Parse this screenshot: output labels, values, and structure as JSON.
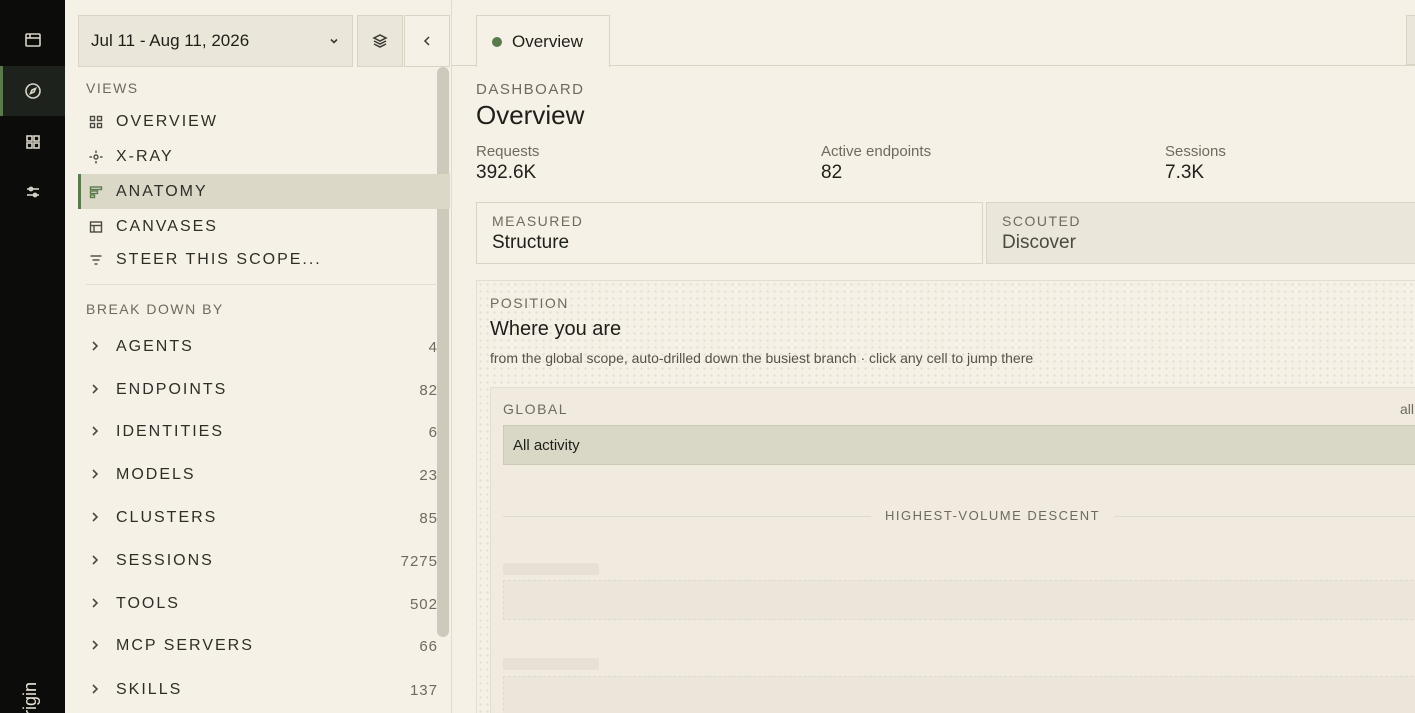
{
  "rail": {
    "items": [
      {
        "icon": "calendar-icon"
      },
      {
        "icon": "compass-icon",
        "active": true
      },
      {
        "icon": "grid-icon"
      },
      {
        "icon": "sliders-icon"
      }
    ],
    "brand": "rigin"
  },
  "sidebar": {
    "date_range": "Jul 11 - Aug 11, 2026",
    "views_title": "VIEWS",
    "views": [
      {
        "label": "OVERVIEW",
        "icon": "grid-icon"
      },
      {
        "label": "X-RAY",
        "icon": "crosshair-icon"
      },
      {
        "label": "ANATOMY",
        "icon": "bars-icon",
        "active": true
      },
      {
        "label": "CANVASES",
        "icon": "canvas-icon"
      },
      {
        "label": "STEER THIS SCOPE...",
        "icon": "filter-icon"
      }
    ],
    "breakdown_title": "BREAK DOWN BY",
    "breakdown": [
      {
        "label": "AGENTS",
        "count": "4"
      },
      {
        "label": "ENDPOINTS",
        "count": "82"
      },
      {
        "label": "IDENTITIES",
        "count": "6"
      },
      {
        "label": "MODELS",
        "count": "23"
      },
      {
        "label": "CLUSTERS",
        "count": "85"
      },
      {
        "label": "SESSIONS",
        "count": "7275"
      },
      {
        "label": "TOOLS",
        "count": "502"
      },
      {
        "label": "MCP SERVERS",
        "count": "66"
      },
      {
        "label": "SKILLS",
        "count": "137"
      }
    ]
  },
  "main": {
    "tab": {
      "label": "Overview"
    },
    "eyebrow": "DASHBOARD",
    "title": "Overview",
    "stats": [
      {
        "label": "Requests",
        "value": "392.6K"
      },
      {
        "label": "Active endpoints",
        "value": "82"
      },
      {
        "label": "Sessions",
        "value": "7.3K"
      }
    ],
    "modes": [
      {
        "kicker": "MEASURED",
        "label": "Structure",
        "selected": true
      },
      {
        "kicker": "SCOUTED",
        "label": "Discover",
        "selected": false
      }
    ],
    "position": {
      "kicker": "POSITION",
      "title": "Where you are",
      "description": "from the global scope, auto-drilled down the busiest branch · click any cell to jump there",
      "global_label": "GLOBAL",
      "global_right": "all",
      "global_bar": "All activity",
      "descent_label": "HIGHEST-VOLUME DESCENT"
    }
  },
  "colors": {
    "accent": "#5a7a4c",
    "background": "#f6f1e7",
    "rail": "#0c0c0a"
  }
}
